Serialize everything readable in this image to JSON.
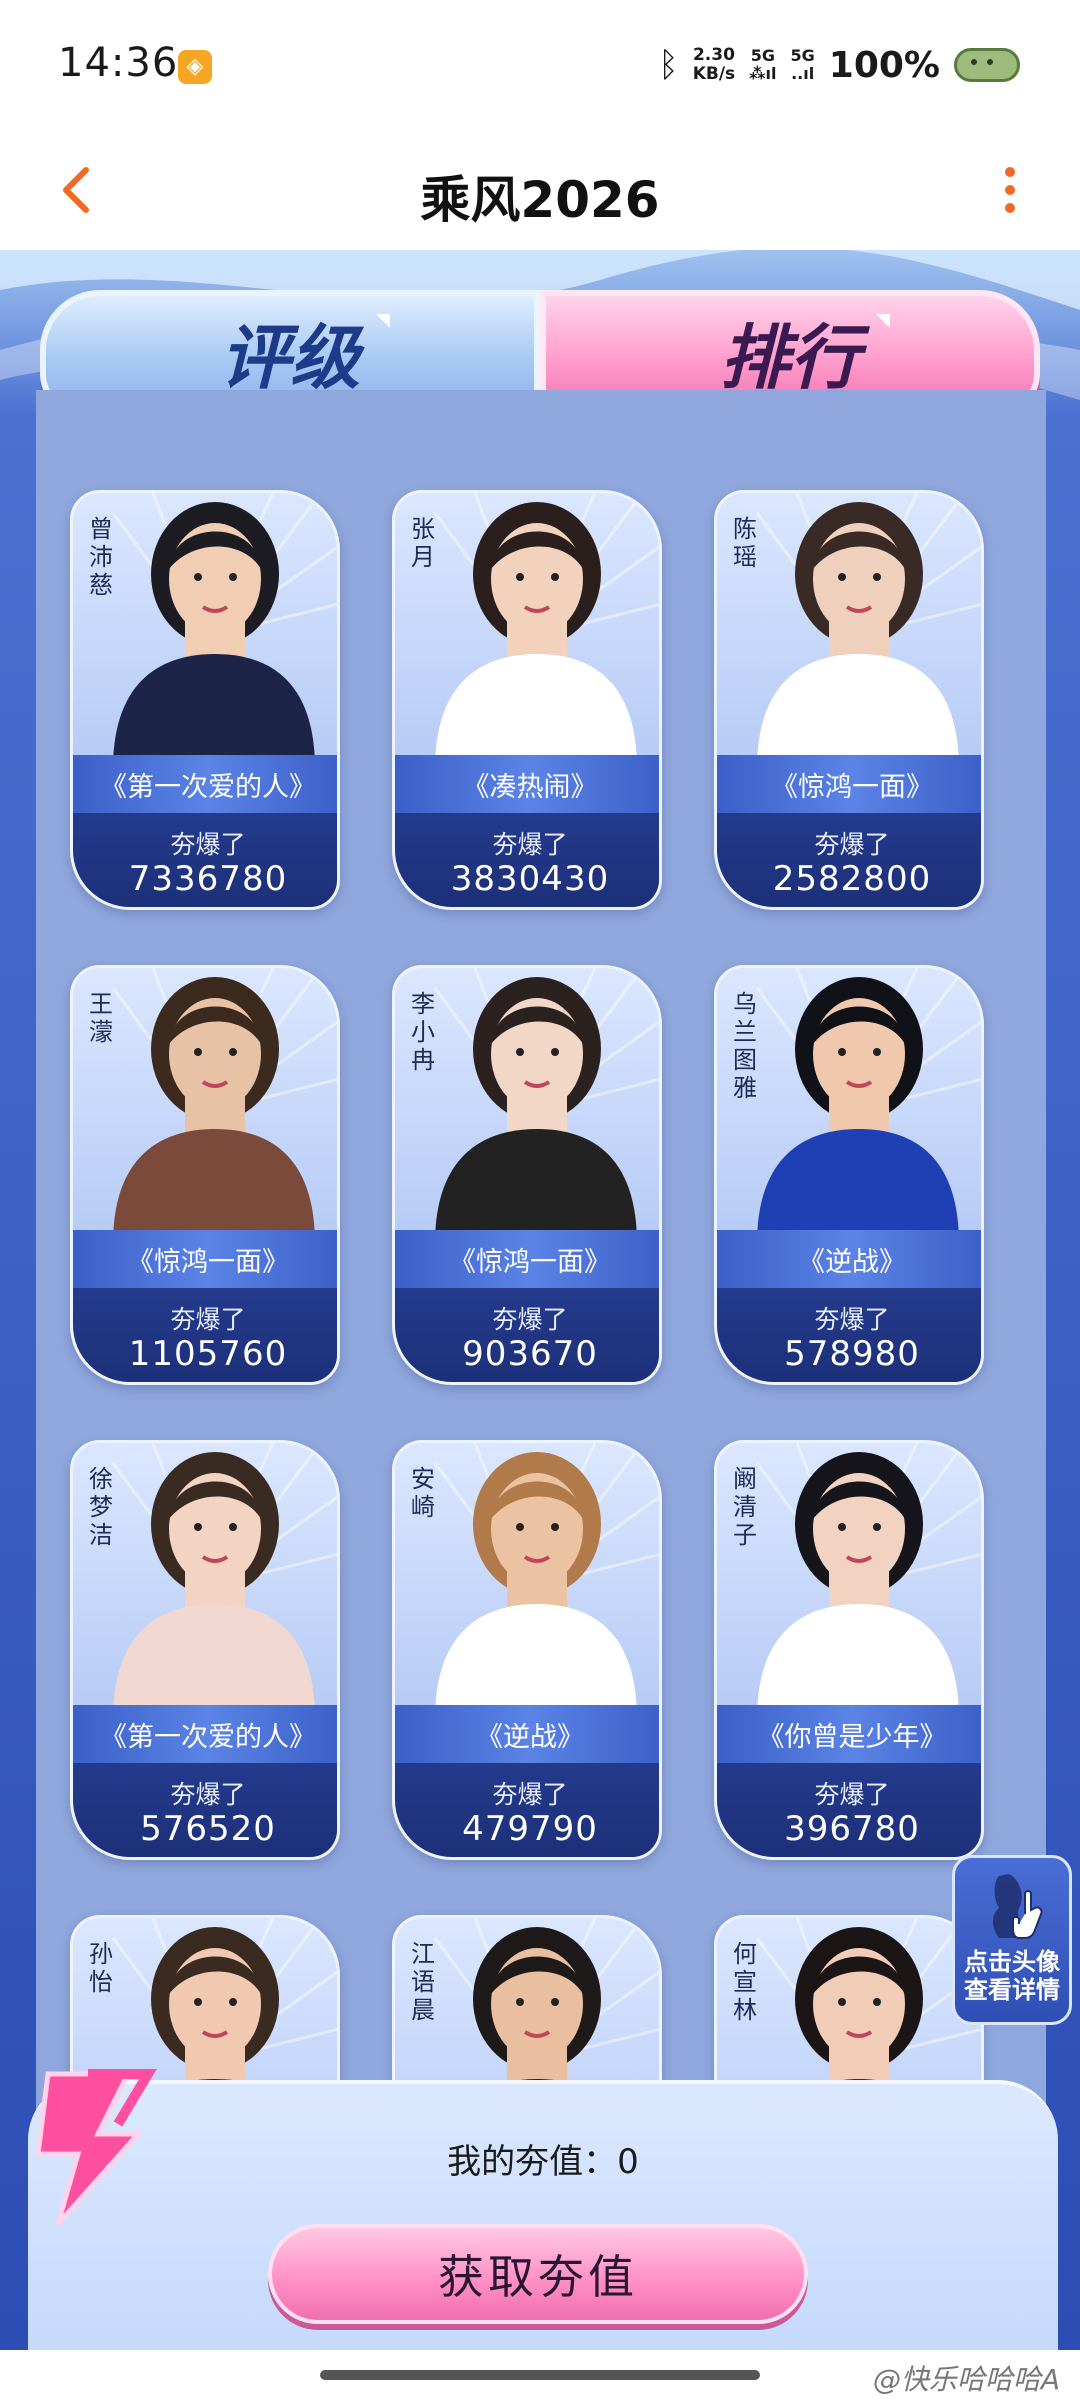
{
  "status_bar": {
    "time": "14:36",
    "net_speed_top": "2.30",
    "net_speed_unit": "KB/s",
    "signal_1": "5G",
    "signal_2": "5G",
    "battery": "100%",
    "icons": [
      "app-notification-icon",
      "bluetooth-icon",
      "signal-icon",
      "battery-icon"
    ]
  },
  "nav": {
    "title": "乘风2026",
    "back_icon": "chevron-left-icon",
    "more_icon": "more-vertical-icon",
    "accent_color": "#f06a25"
  },
  "tabs": [
    {
      "label": "评级",
      "active": false
    },
    {
      "label": "排行",
      "active": true
    }
  ],
  "stat_label": "夯爆了",
  "cards": [
    {
      "name": "曾沛慈",
      "song": "《第一次爱的人》",
      "label": "夯爆了",
      "value": "7336780"
    },
    {
      "name": "张月",
      "song": "《凑热闹》",
      "label": "夯爆了",
      "value": "3830430"
    },
    {
      "name": "陈瑶",
      "song": "《惊鸿一面》",
      "label": "夯爆了",
      "value": "2582800"
    },
    {
      "name": "王濛",
      "song": "《惊鸿一面》",
      "label": "夯爆了",
      "value": "1105760"
    },
    {
      "name": "李小冉",
      "song": "《惊鸿一面》",
      "label": "夯爆了",
      "value": "903670"
    },
    {
      "name": "乌兰图雅",
      "song": "《逆战》",
      "label": "夯爆了",
      "value": "578980"
    },
    {
      "name": "徐梦洁",
      "song": "《第一次爱的人》",
      "label": "夯爆了",
      "value": "576520"
    },
    {
      "name": "安崎",
      "song": "《逆战》",
      "label": "夯爆了",
      "value": "479790"
    },
    {
      "name": "阚清子",
      "song": "《你曾是少年》",
      "label": "夯爆了",
      "value": "396780"
    },
    {
      "name": "孙怡",
      "song": "",
      "label": "",
      "value": ""
    },
    {
      "name": "江语晨",
      "song": "",
      "label": "",
      "value": ""
    },
    {
      "name": "何宣林",
      "song": "",
      "label": "",
      "value": ""
    }
  ],
  "tip": {
    "text": "点击头像查看详情",
    "icon": "hand-pointer-icon"
  },
  "bottom": {
    "my_value": "我的夯值：0",
    "button": "获取夯值"
  },
  "watermark": "@快乐哈哈哈A",
  "colors": {
    "panel": "#8fa7dc",
    "frame": "#3e5fc9",
    "pink_tab": "#ff9fcd",
    "blue_tab": "#a9c9f4",
    "stat_box": "#1c2f78"
  }
}
